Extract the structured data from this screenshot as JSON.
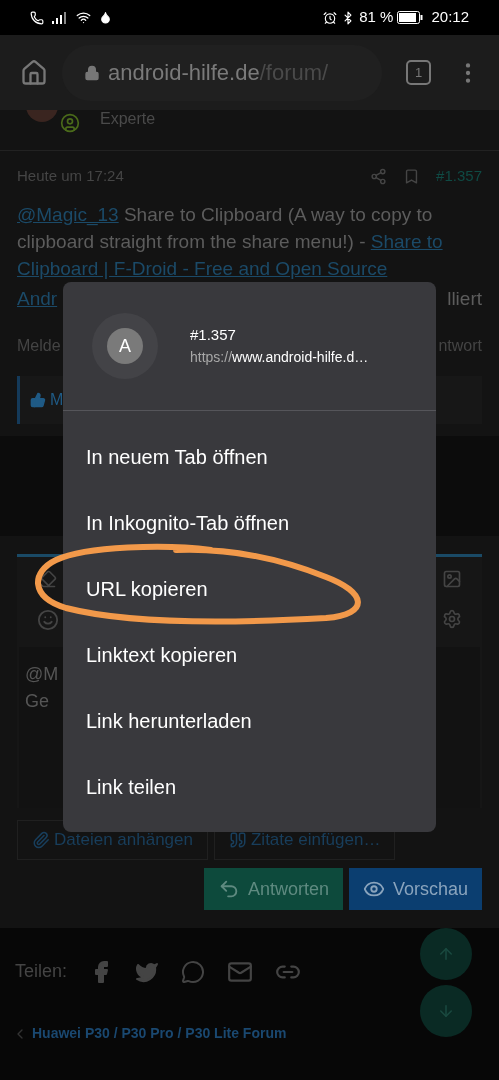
{
  "status_bar": {
    "battery": "81 %",
    "time": "20:12"
  },
  "browser": {
    "host": "android-hilfe.de",
    "path": "/forum/",
    "tab_count": "1"
  },
  "post": {
    "author_rank": "Experte",
    "date": "Heute um 17:24",
    "number": "#1.357",
    "lines": [
      [
        {
          "text": "@Magic_13",
          "link": true
        },
        {
          "text": " Share to Clipboard (A way to copy to",
          "link": false
        }
      ],
      [
        {
          "text": "clipboard straight from the share menu!) - ",
          "link": false
        },
        {
          "text": "Share to",
          "link": true
        }
      ],
      [
        {
          "text": "Clipboard | F-Droid - Free and Open Source",
          "link": true
        }
      ]
    ],
    "cut_line": {
      "left": "Andr",
      "right": "lliert"
    },
    "meta_row": {
      "left": "Melde",
      "right": "ntwort"
    },
    "reaction": "M"
  },
  "editor": {
    "lines": [
      "@M",
      "Ge"
    ]
  },
  "attach_buttons": [
    "Dateien anhängen",
    "Zitate einfügen…"
  ],
  "action_buttons": [
    {
      "label": "Antworten",
      "kind": "reply"
    },
    {
      "label": "Vorschau",
      "kind": "preview"
    }
  ],
  "share": {
    "label": "Teilen:"
  },
  "breadcrumb": "Huawei P30 / P30 Pro / P30 Lite Forum",
  "context_menu": {
    "avatar_letter": "A",
    "title": "#1.357",
    "url_scheme": "https://",
    "url_rest": "www.android-hilfe.d…",
    "items": [
      "In neuem Tab öffnen",
      "In Inkognito-Tab öffnen",
      "URL kopieren",
      "Linktext kopieren",
      "Link herunterladen",
      "Link teilen"
    ]
  }
}
